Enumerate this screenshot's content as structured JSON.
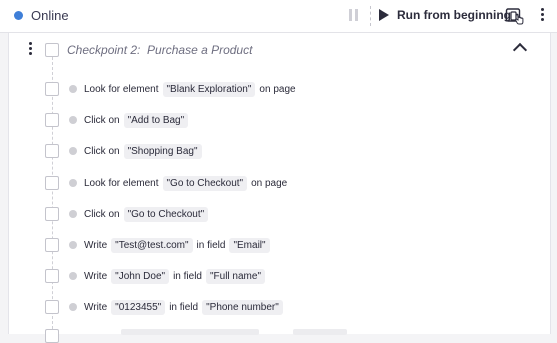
{
  "status": {
    "label": "Online",
    "color": "#3f7fd8"
  },
  "toolbar": {
    "pause_icon": "pause-icon",
    "run_label": "Run from beginning",
    "device_icon": "device-preview-icon",
    "menu_icon": "kebab-menu-icon"
  },
  "checkpoint": {
    "title": "Checkpoint 2:  Purchase a Product",
    "collapse_icon": "chevron-up-icon"
  },
  "steps": [
    {
      "prefix": "Look for element",
      "value": "\"Blank Exploration\"",
      "suffix": "on page"
    },
    {
      "prefix": "Click on",
      "value": "\"Add to Bag\""
    },
    {
      "prefix": "Click on",
      "value": "\"Shopping Bag\""
    },
    {
      "prefix": "Look for element",
      "value": "\"Go to Checkout\"",
      "suffix": "on page"
    },
    {
      "prefix": "Click on",
      "value": "\"Go to Checkout\""
    },
    {
      "prefix": "Write",
      "value": "\"Test@test.com\"",
      "middle": "in field",
      "field": "\"Email\""
    },
    {
      "prefix": "Write",
      "value": "\"John Doe\"",
      "middle": "in field",
      "field": "\"Full name\""
    },
    {
      "prefix": "Write",
      "value": "\"0123455\"",
      "middle": "in field",
      "field": "\"Phone number\""
    }
  ]
}
